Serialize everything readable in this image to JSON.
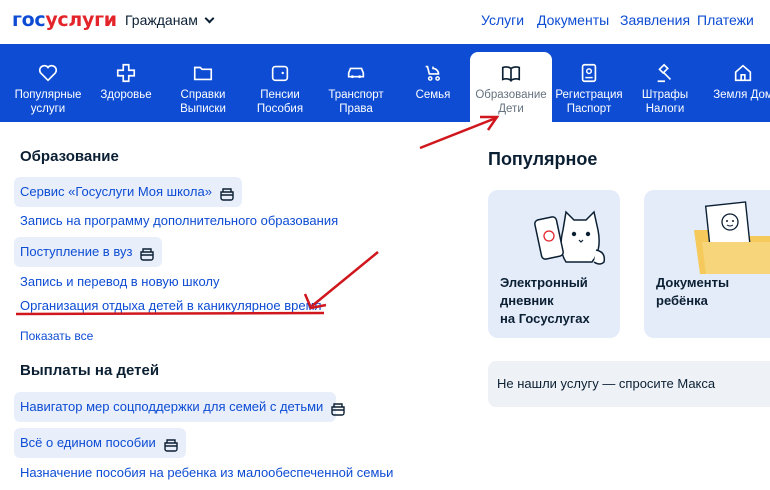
{
  "header": {
    "logo_part1": "гос",
    "logo_part2": "услуги",
    "audience": "Гражданам",
    "nav": [
      "Услуги",
      "Документы",
      "Заявления",
      "Платежи"
    ]
  },
  "categories": [
    {
      "label": "Популярные\nуслуги",
      "icon": "heart-icon"
    },
    {
      "label": "Здоровье",
      "icon": "medical-cross-icon"
    },
    {
      "label": "Справки\nВыписки",
      "icon": "folder-icon"
    },
    {
      "label": "Пенсии\nПособия",
      "icon": "wallet-icon"
    },
    {
      "label": "Транспорт\nПрава",
      "icon": "car-icon"
    },
    {
      "label": "Семья",
      "icon": "stroller-icon"
    },
    {
      "label": "Образование\nДети",
      "icon": "book-icon",
      "active": true
    },
    {
      "label": "Регистрация\nПаспорт",
      "icon": "id-card-icon"
    },
    {
      "label": "Штрафы\nНалоги",
      "icon": "gavel-icon"
    },
    {
      "label": "Земля Дом",
      "icon": "house-icon"
    }
  ],
  "education": {
    "heading": "Образование",
    "items": [
      "Сервис «Госуслуги Моя школа»",
      "Запись на программу дополнительного образования",
      "Поступление в вуз",
      "Запись и перевод в новую школу",
      "Организация отдыха детей в каникулярное время"
    ],
    "show_all": "Показать все"
  },
  "payments": {
    "heading": "Выплаты на детей",
    "items": [
      "Навигатор мер соцподдержки для семей с детьми",
      "Всё о едином пособии",
      "Назначение пособия на ребенка из малообеспеченной семьи"
    ]
  },
  "popular": {
    "heading": "Популярное",
    "cards": [
      {
        "title": "Электронный\nдневник\nна Госуслугах"
      },
      {
        "title": "Документы\nребёнка"
      }
    ],
    "ask": "Не нашли услугу — спросите Макса"
  },
  "colors": {
    "brand_blue": "#0d4cd3",
    "brand_red": "#e3252b",
    "link_pill": "#e8effb",
    "annotation_red": "#d0171d"
  }
}
